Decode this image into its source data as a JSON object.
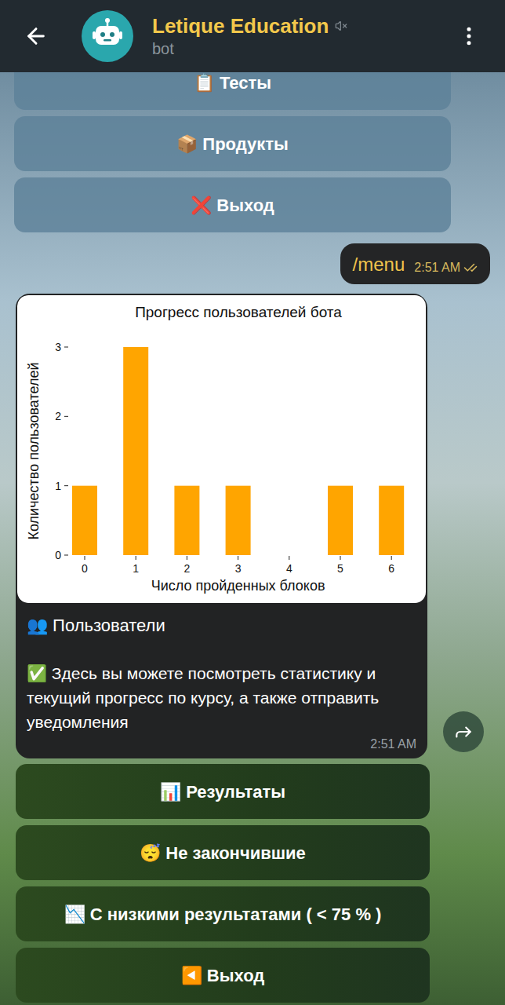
{
  "header": {
    "title": "Letique Education",
    "subtitle": "bot",
    "muted": true
  },
  "reply_keyboard": [
    "📋 Тесты",
    "📦 Продукты",
    "❌ Выход"
  ],
  "outgoing": {
    "text": "/menu",
    "time": "2:51 AM",
    "read": true
  },
  "incoming": {
    "chart": {
      "title": "Прогресс пользователей бота",
      "y_label": "Количество пользователей",
      "x_label": "Число пройденных блоков",
      "x_ticks": [
        "0",
        "1",
        "2",
        "3",
        "4",
        "5",
        "6"
      ],
      "y_ticks": [
        "0",
        "1",
        "2",
        "3"
      ],
      "values": [
        1,
        3,
        1,
        1,
        0,
        1,
        1
      ]
    },
    "title": "👥 Пользователи",
    "body": "✅ Здесь вы можете посмотреть статистику и текущий прогресс по курсу, а также отправить уведомления",
    "time": "2:51 AM"
  },
  "inline_keyboard": [
    "📊 Результаты",
    "😴 Не закончившие",
    "📉 С низкими результатами ( < 75 % )",
    "◀️ Выход"
  ]
}
